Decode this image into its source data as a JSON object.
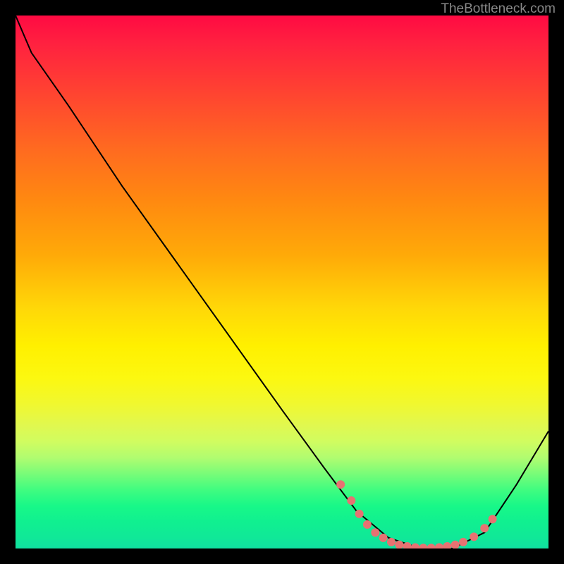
{
  "watermark": "TheBottleneck.com",
  "chart_data": {
    "type": "line",
    "title": "",
    "xlabel": "",
    "ylabel": "",
    "xlim": [
      0,
      100
    ],
    "ylim": [
      0,
      100
    ],
    "curve_points": [
      {
        "x": 0,
        "y": 100
      },
      {
        "x": 3,
        "y": 93
      },
      {
        "x": 10,
        "y": 83
      },
      {
        "x": 20,
        "y": 68
      },
      {
        "x": 30,
        "y": 54
      },
      {
        "x": 40,
        "y": 40
      },
      {
        "x": 50,
        "y": 26
      },
      {
        "x": 58,
        "y": 15
      },
      {
        "x": 64,
        "y": 7
      },
      {
        "x": 70,
        "y": 2
      },
      {
        "x": 76,
        "y": 0
      },
      {
        "x": 82,
        "y": 0
      },
      {
        "x": 88,
        "y": 3
      },
      {
        "x": 94,
        "y": 12
      },
      {
        "x": 100,
        "y": 22
      }
    ],
    "marker_points": [
      {
        "x": 61,
        "y": 12
      },
      {
        "x": 63,
        "y": 9
      },
      {
        "x": 64.5,
        "y": 6.5
      },
      {
        "x": 66,
        "y": 4.5
      },
      {
        "x": 67.5,
        "y": 3
      },
      {
        "x": 69,
        "y": 2
      },
      {
        "x": 70.5,
        "y": 1.2
      },
      {
        "x": 72,
        "y": 0.7
      },
      {
        "x": 73.5,
        "y": 0.4
      },
      {
        "x": 75,
        "y": 0.2
      },
      {
        "x": 76.5,
        "y": 0.1
      },
      {
        "x": 78,
        "y": 0.1
      },
      {
        "x": 79.5,
        "y": 0.2
      },
      {
        "x": 81,
        "y": 0.4
      },
      {
        "x": 82.5,
        "y": 0.7
      },
      {
        "x": 84,
        "y": 1.2
      },
      {
        "x": 86,
        "y": 2.2
      },
      {
        "x": 88,
        "y": 3.8
      },
      {
        "x": 89.5,
        "y": 5.5
      }
    ],
    "marker_color": "#e77272",
    "line_color": "#000000"
  }
}
